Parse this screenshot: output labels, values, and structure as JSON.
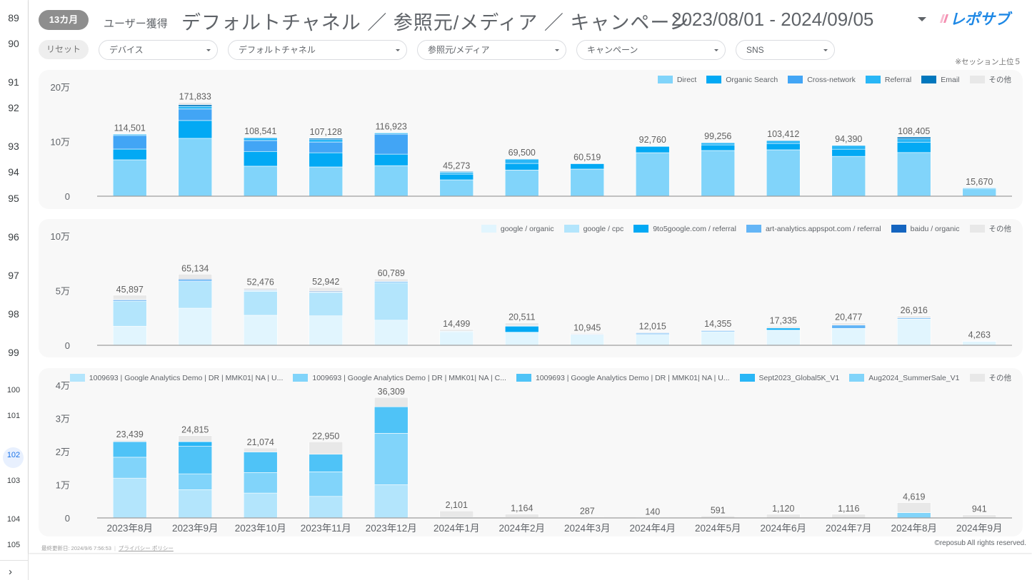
{
  "gutter": {
    "rows": [
      "89",
      "90",
      "91",
      "92",
      "93",
      "94",
      "95",
      "96",
      "97",
      "98",
      "99",
      "100",
      "101",
      "102",
      "103",
      "104",
      "105"
    ],
    "active_row": "102",
    "expand_icon": "chevron-right-icon"
  },
  "header": {
    "period_badge": "13カ月",
    "subtitle": "ユーザー獲得",
    "title": "デフォルトチャネル ／ 参照元/メディア ／ キャンペーン",
    "date_range": "2023/08/01 - 2024/09/05",
    "logo_text": "レポサブ"
  },
  "filters": {
    "reset_label": "リセット",
    "items": [
      {
        "label": "デバイス"
      },
      {
        "label": "デフォルトチャネル"
      },
      {
        "label": "参照元/メディア"
      },
      {
        "label": "キャンペーン"
      },
      {
        "label": "SNS"
      }
    ],
    "note": "※セッション上位５"
  },
  "colors": {
    "axis": "#9e9e9e",
    "grid_text": "#5f6368",
    "other": "#e8e8e8"
  },
  "chart_data": [
    {
      "type": "bar",
      "stacked": true,
      "title": "デフォルトチャネル",
      "categories": [
        "2023年8月",
        "2023年9月",
        "2023年10月",
        "2023年11月",
        "2023年12月",
        "2024年1月",
        "2024年2月",
        "2024年3月",
        "2024年4月",
        "2024年5月",
        "2024年6月",
        "2024年7月",
        "2024年8月",
        "2024年9月"
      ],
      "ylim": [
        0,
        200000
      ],
      "yticks": [
        {
          "value": 0,
          "label": "0"
        },
        {
          "value": 100000,
          "label": "10万"
        },
        {
          "value": 200000,
          "label": "20万"
        }
      ],
      "totals": [
        114501,
        171833,
        108541,
        107128,
        116923,
        45273,
        69500,
        60519,
        92760,
        99256,
        103412,
        94390,
        108405,
        15670
      ],
      "total_labels": [
        "114,501",
        "171,833",
        "108,541",
        "107,128",
        "116,923",
        "45,273",
        "69,500",
        "60,519",
        "92,760",
        "99,256",
        "103,412",
        "94,390",
        "108,405",
        "15,670"
      ],
      "legend_position": "top-right",
      "series": [
        {
          "name": "Direct",
          "color": "#81d4fa",
          "values": [
            66700,
            106000,
            55000,
            53600,
            56000,
            30000,
            48000,
            49700,
            79700,
            83700,
            85000,
            73000,
            80000,
            13400
          ]
        },
        {
          "name": "Organic Search",
          "color": "#03a9f4",
          "values": [
            19600,
            32700,
            27000,
            26000,
            21000,
            10500,
            12000,
            10800,
            12000,
            10300,
            11700,
            13000,
            19000,
            2100
          ]
        },
        {
          "name": "Cross-network",
          "color": "#42a5f5",
          "values": [
            25000,
            21000,
            20000,
            19600,
            36700,
            0,
            0,
            0,
            0,
            0,
            0,
            0,
            0,
            0
          ]
        },
        {
          "name": "Referral",
          "color": "#29b6f6",
          "values": [
            2700,
            5000,
            5000,
            4500,
            2700,
            3500,
            8000,
            0,
            500,
            4000,
            5000,
            7000,
            6000,
            170
          ]
        },
        {
          "name": "Email",
          "color": "#0277bd",
          "values": [
            0,
            3000,
            0,
            2500,
            0,
            1273,
            0,
            0,
            0,
            0,
            0,
            0,
            3405,
            0
          ]
        },
        {
          "name": "その他",
          "color": "#e8e8e8",
          "values": [
            501,
            4133,
            1541,
            928,
            523,
            0,
            1500,
            19,
            560,
            1256,
            1712,
            1390,
            0,
            0
          ]
        }
      ]
    },
    {
      "type": "bar",
      "stacked": true,
      "title": "参照元/メディア",
      "categories": [
        "2023年8月",
        "2023年9月",
        "2023年10月",
        "2023年11月",
        "2023年12月",
        "2024年1月",
        "2024年2月",
        "2024年3月",
        "2024年4月",
        "2024年5月",
        "2024年6月",
        "2024年7月",
        "2024年8月",
        "2024年9月"
      ],
      "ylim": [
        0,
        100000
      ],
      "yticks": [
        {
          "value": 0,
          "label": "0"
        },
        {
          "value": 50000,
          "label": "5万"
        },
        {
          "value": 100000,
          "label": "10万"
        }
      ],
      "totals": [
        45897,
        65134,
        52476,
        52942,
        60789,
        14499,
        20511,
        10945,
        12015,
        14355,
        17335,
        20477,
        26916,
        4263
      ],
      "total_labels": [
        "45,897",
        "65,134",
        "52,476",
        "52,942",
        "60,789",
        "14,499",
        "20,511",
        "10,945",
        "12,015",
        "14,355",
        "17,335",
        "20,477",
        "26,916",
        "4,263"
      ],
      "legend_position": "top-right",
      "series": [
        {
          "name": "google / organic",
          "color": "#e1f5fe",
          "values": [
            17500,
            34000,
            27500,
            27000,
            23000,
            12500,
            12000,
            9500,
            10000,
            12500,
            14000,
            15500,
            24000,
            3800
          ]
        },
        {
          "name": "google / cpc",
          "color": "#b3e5fc",
          "values": [
            23000,
            24500,
            22000,
            21500,
            34500,
            0,
            0,
            0,
            0,
            0,
            0,
            0,
            0,
            0
          ]
        },
        {
          "name": "9to5google.com / referral",
          "color": "#03a9f4",
          "values": [
            0,
            0,
            500,
            0,
            0,
            0,
            5500,
            0,
            0,
            0,
            1800,
            0,
            0,
            0
          ]
        },
        {
          "name": "art-analytics.appspot.com / referral",
          "color": "#64b5f6",
          "values": [
            1000,
            1500,
            500,
            500,
            1000,
            500,
            500,
            600,
            1200,
            1000,
            0,
            3000,
            1000,
            300
          ]
        },
        {
          "name": "baidu / organic",
          "color": "#1565c0",
          "values": [
            600,
            700,
            300,
            700,
            0,
            0,
            0,
            0,
            300,
            300,
            0,
            0,
            400,
            0
          ]
        },
        {
          "name": "その他",
          "color": "#e8e8e8",
          "values": [
            3797,
            4434,
            1676,
            3242,
            2289,
            1499,
            2511,
            845,
            515,
            555,
            1535,
            1977,
            1516,
            163
          ]
        }
      ]
    },
    {
      "type": "bar",
      "stacked": true,
      "title": "キャンペーン",
      "categories": [
        "2023年8月",
        "2023年9月",
        "2023年10月",
        "2023年11月",
        "2023年12月",
        "2024年1月",
        "2024年2月",
        "2024年3月",
        "2024年4月",
        "2024年5月",
        "2024年6月",
        "2024年7月",
        "2024年8月",
        "2024年9月"
      ],
      "ylim": [
        0,
        40000
      ],
      "yticks": [
        {
          "value": 0,
          "label": "0"
        },
        {
          "value": 10000,
          "label": "1万"
        },
        {
          "value": 20000,
          "label": "2万"
        },
        {
          "value": 30000,
          "label": "3万"
        },
        {
          "value": 40000,
          "label": "4万"
        }
      ],
      "totals": [
        23439,
        24815,
        21074,
        22950,
        36309,
        2101,
        1164,
        287,
        140,
        591,
        1120,
        1116,
        4619,
        941
      ],
      "total_labels": [
        "23,439",
        "24,815",
        "21,074",
        "22,950",
        "36,309",
        "2,101",
        "1,164",
        "287",
        "140",
        "591",
        "1,120",
        "1,116",
        "4,619",
        "941"
      ],
      "legend_position": "top-right",
      "series": [
        {
          "name": "1009693 | Google Analytics Demo | DR | MMK01| NA | U...",
          "color": "#b3e5fc",
          "values": [
            12000,
            8500,
            7500,
            6500,
            10000,
            0,
            0,
            0,
            0,
            0,
            0,
            0,
            0,
            0
          ]
        },
        {
          "name": "1009693 | Google Analytics Demo | DR | MMK01| NA | C...",
          "color": "#81d4fa",
          "values": [
            6300,
            4800,
            6200,
            7400,
            15500,
            0,
            0,
            0,
            0,
            0,
            0,
            0,
            0,
            0
          ]
        },
        {
          "name": "1009693 | Google Analytics Demo | DR | MMK01| NA | U...",
          "color": "#4fc3f7",
          "values": [
            4700,
            8300,
            6200,
            5300,
            8000,
            200,
            150,
            100,
            60,
            0,
            0,
            0,
            0,
            60
          ]
        },
        {
          "name": "Sept2023_Global5K_V1",
          "color": "#29b6f6",
          "values": [
            0,
            1400,
            0,
            0,
            0,
            0,
            0,
            0,
            0,
            0,
            0,
            0,
            0,
            0
          ]
        },
        {
          "name": "Aug2024_SummerSale_V1",
          "color": "#81d4fa",
          "values": [
            0,
            0,
            0,
            0,
            0,
            0,
            0,
            0,
            0,
            0,
            0,
            0,
            1600,
            0
          ]
        },
        {
          "name": "その他",
          "color": "#e8e8e8",
          "values": [
            439,
            1815,
            1174,
            3750,
            2809,
            1901,
            1014,
            187,
            80,
            591,
            1120,
            1116,
            3019,
            881
          ]
        }
      ]
    }
  ],
  "footer": {
    "last_updated": "最終更新日: 2024/9/6 7:56:53",
    "privacy_link": "プライバシー ポリシー",
    "copyright": "©reposub All rights reserved."
  }
}
